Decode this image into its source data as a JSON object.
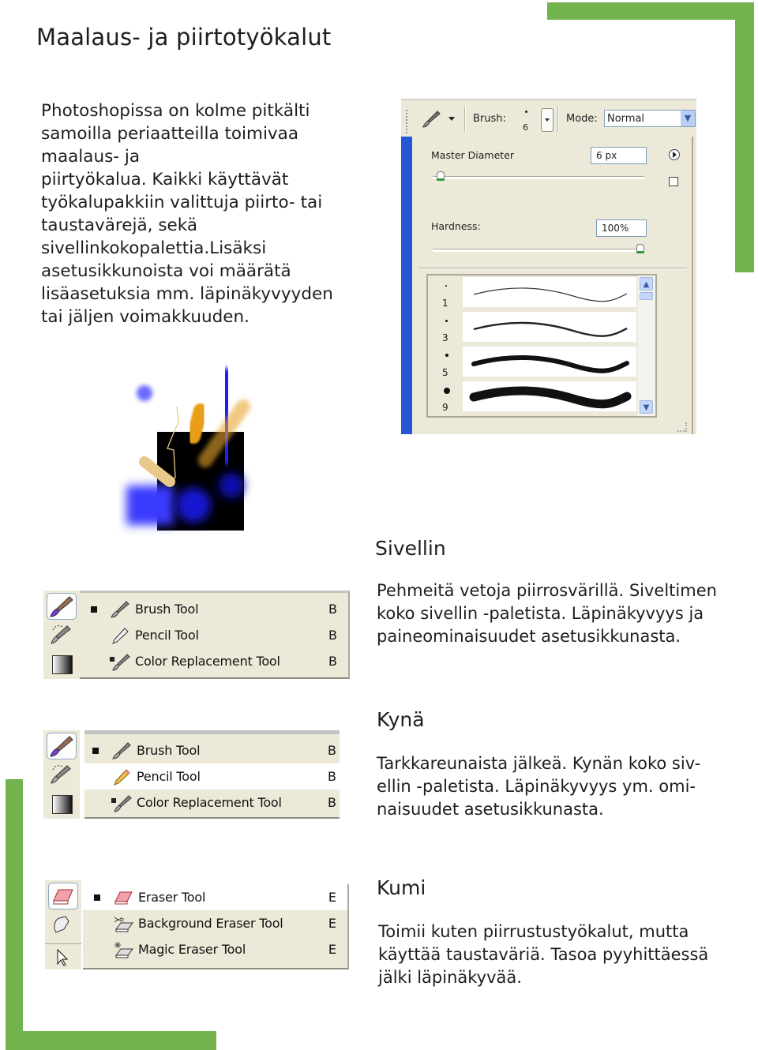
{
  "page": {
    "title": "Maalaus- ja piirtotyökalut",
    "accent_color": "#72b34d",
    "intro_lines": [
      "Photoshopissa on kolme pitkälti",
      "samoilla periaatteilla toimivaa",
      "maalaus- ja",
      "piirtyökalua. Kaikki käyttävät",
      "työkalupakkiin valittuja piirto- tai",
      "taustavärejä, sekä",
      "sivellinkokopalettia.Lisäksi",
      "asetusikkunoista voi määrätä",
      "lisäasetuksia mm. läpinäkyvyyden",
      "tai jäljen voimakkuuden."
    ]
  },
  "options_bar": {
    "tool_icon": "brush-icon",
    "brush_label": "Brush:",
    "brush_size": "6",
    "mode_label": "Mode:",
    "mode_value": "Normal"
  },
  "brush_panel": {
    "master_diameter_label": "Master Diameter",
    "master_diameter_value": "6 px",
    "master_diameter_slider": 0.02,
    "hardness_label": "Hardness:",
    "hardness_value": "100%",
    "hardness_slider": 1.0,
    "presets": [
      {
        "size": "1"
      },
      {
        "size": "3"
      },
      {
        "size": "5"
      },
      {
        "size": "9"
      }
    ]
  },
  "menus": {
    "brush_menu": {
      "items": [
        {
          "label": "Brush Tool",
          "key": "B",
          "icon": "brush-icon",
          "active": true
        },
        {
          "label": "Pencil Tool",
          "key": "B",
          "icon": "pencil-icon",
          "active": false
        },
        {
          "label": "Color Replacement Tool",
          "key": "B",
          "icon": "color-replacement-icon",
          "active": false
        }
      ]
    },
    "pencil_menu": {
      "items": [
        {
          "label": "Brush Tool",
          "key": "B",
          "icon": "brush-icon",
          "active": true
        },
        {
          "label": "Pencil Tool",
          "key": "B",
          "icon": "pencil-icon",
          "active": false,
          "highlighted": true
        },
        {
          "label": "Color Replacement Tool",
          "key": "B",
          "icon": "color-replacement-icon",
          "active": false
        }
      ]
    },
    "eraser_menu": {
      "items": [
        {
          "label": "Eraser Tool",
          "key": "E",
          "icon": "eraser-icon",
          "active": true,
          "highlighted": true
        },
        {
          "label": "Background Eraser Tool",
          "key": "E",
          "icon": "background-eraser-icon",
          "active": false
        },
        {
          "label": "Magic Eraser Tool",
          "key": "E",
          "icon": "magic-eraser-icon",
          "active": false
        }
      ]
    }
  },
  "sections": [
    {
      "title": "Sivellin",
      "lines": [
        "Pehmeitä vetoja piirrosvärillä. Siveltimen",
        "koko sivellin -paletista. Läpinäkyvyys ja",
        "paineominaisuudet asetusikkunasta."
      ]
    },
    {
      "title": "Kynä",
      "lines": [
        "Tarkkareunaista jälkeä. Kynän koko siv-",
        "ellin -paletista. Läpinäkyvyys ym. omi-",
        "naisuudet asetusikkunasta."
      ]
    },
    {
      "title": "Kumi",
      "lines": [
        "Toimii kuten piirrustustyökalut, mutta",
        "käyttää taustaväriä. Tasoa pyyhittäessä",
        "jälki läpinäkyvää."
      ]
    }
  ]
}
